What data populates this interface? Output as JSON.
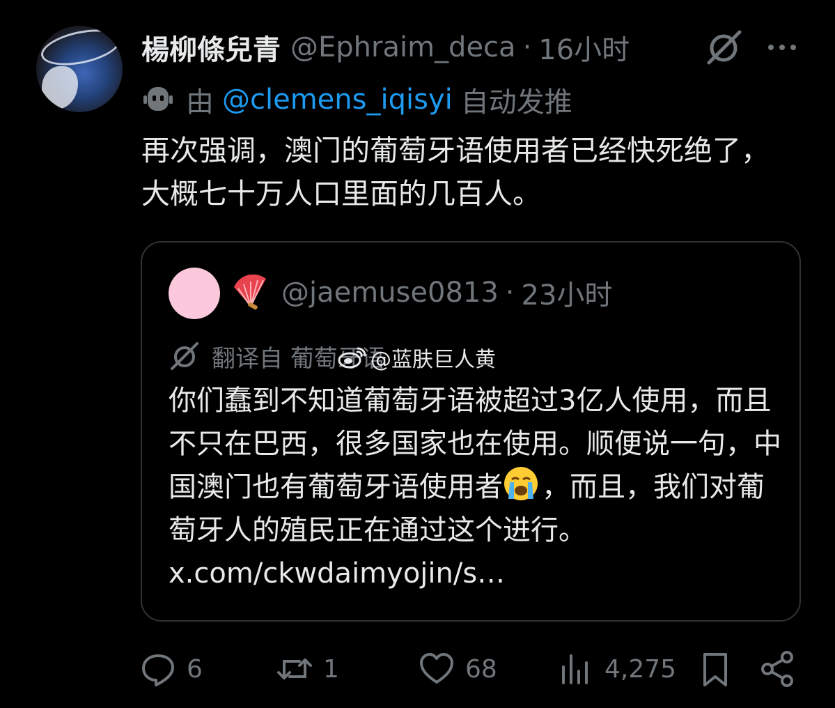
{
  "post": {
    "author_name": "楊柳條兒青",
    "author_handle": "@Ephraim_deca",
    "separator": "·",
    "time": "16小时",
    "automated": {
      "prefix": "由",
      "bot_handle": "@clemens_iqisyi",
      "suffix": "自动发推"
    },
    "text": "再次强调，澳门的葡萄牙语使用者已经快死绝了，大概七十万人口里面的几百人。"
  },
  "quote": {
    "handle": "@jaemuse0813",
    "separator": "·",
    "time": "23小时",
    "translated_label": "翻译自 葡萄牙语",
    "text_before_emoji": "你们蠢到不知道葡萄牙语被超过3亿人使用，而且不只在巴西，很多国家也在使用。顺便说一句，中国澳门也有葡萄牙语使用者",
    "text_after_emoji": "，而且，我们对葡萄牙人的殖民正在通过这个进行。",
    "link": "x.com/ckwdaimyojin/s…"
  },
  "watermark": {
    "text": "@蓝肤巨人黄"
  },
  "actions": {
    "replies": "6",
    "reposts": "1",
    "likes": "68",
    "views": "4,275"
  },
  "icons": {
    "more": "more-icon",
    "grok": "grok-icon",
    "robot": "robot-icon",
    "fan": "fan-emoji-icon",
    "translate": "translate-icon",
    "weibo": "weibo-logo-icon",
    "cry": "crying-face-emoji-icon",
    "reply": "reply-icon",
    "retweet": "retweet-icon",
    "like": "heart-icon",
    "views": "views-icon",
    "bookmark": "bookmark-icon",
    "share": "share-icon"
  },
  "colors": {
    "background": "#000000",
    "text": "#e7e9ea",
    "muted": "#71767b",
    "link": "#1d9bf0",
    "border": "#2f3336"
  }
}
